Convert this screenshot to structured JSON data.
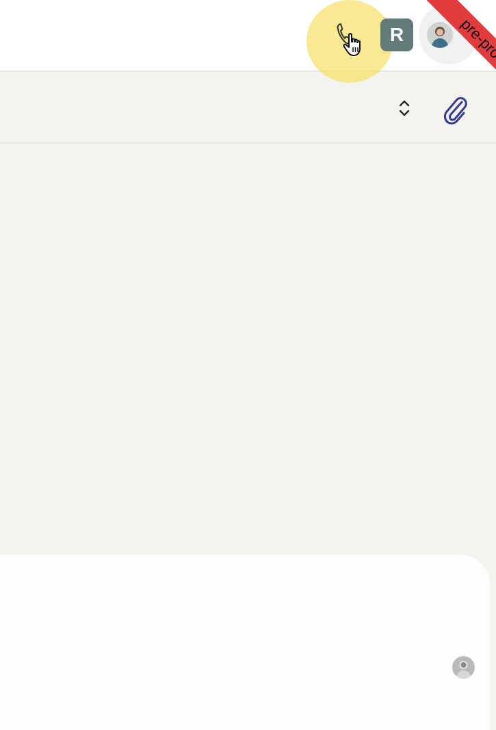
{
  "header": {
    "call_button": {
      "icon": "phone-icon",
      "cursor": "hand-pointer-icon"
    },
    "workspace_badge": {
      "label": "R",
      "color": "#627b78"
    },
    "user_avatar": {
      "icon": "user-avatar-photo"
    },
    "env_ribbon": {
      "label": "pre-prod",
      "color": "#e23c3f"
    }
  },
  "toolbar": {
    "sort_icon": "sort-updown-icon",
    "attach_icon": "paperclip-icon",
    "accent_color": "#3b3c8f"
  },
  "composer": {
    "avatar_icon": "user-avatar-photo"
  }
}
